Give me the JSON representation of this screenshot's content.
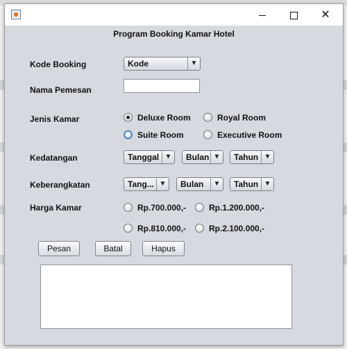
{
  "window": {
    "icon": "java-cup-icon",
    "min_glyph": "—",
    "close_glyph": "✕"
  },
  "form": {
    "title": "Program Booking Kamar Hotel",
    "labels": {
      "kode_booking": "Kode Booking",
      "nama_pemesan": "Nama Pemesan",
      "jenis_kamar": "Jenis Kamar",
      "kedatangan": "Kedatangan",
      "keberangkatan": "Keberangkatan",
      "harga_kamar": "Harga Kamar"
    },
    "kode_combo": "Kode",
    "nama_value": "",
    "room_types": {
      "deluxe": "Deluxe Room",
      "royal": "Royal Room",
      "suite": "Suite Room",
      "executive": "Executive Room",
      "selected": "Deluxe Room"
    },
    "kedatangan": {
      "tanggal": "Tanggal",
      "bulan": "Bulan",
      "tahun": "Tahun"
    },
    "keberangkatan": {
      "tanggal": "Tang...",
      "bulan": "Bulan",
      "tahun": "Tahun"
    },
    "prices": {
      "p1": "Rp.700.000,-",
      "p2": "Rp.1.200.000,-",
      "p3": "Rp.810.000,-",
      "p4": "Rp.2.100.000,-"
    },
    "buttons": {
      "pesan": "Pesan",
      "batal": "Batal",
      "hapus": "Hapus"
    },
    "output": ""
  },
  "arrow_glyph": "▼"
}
